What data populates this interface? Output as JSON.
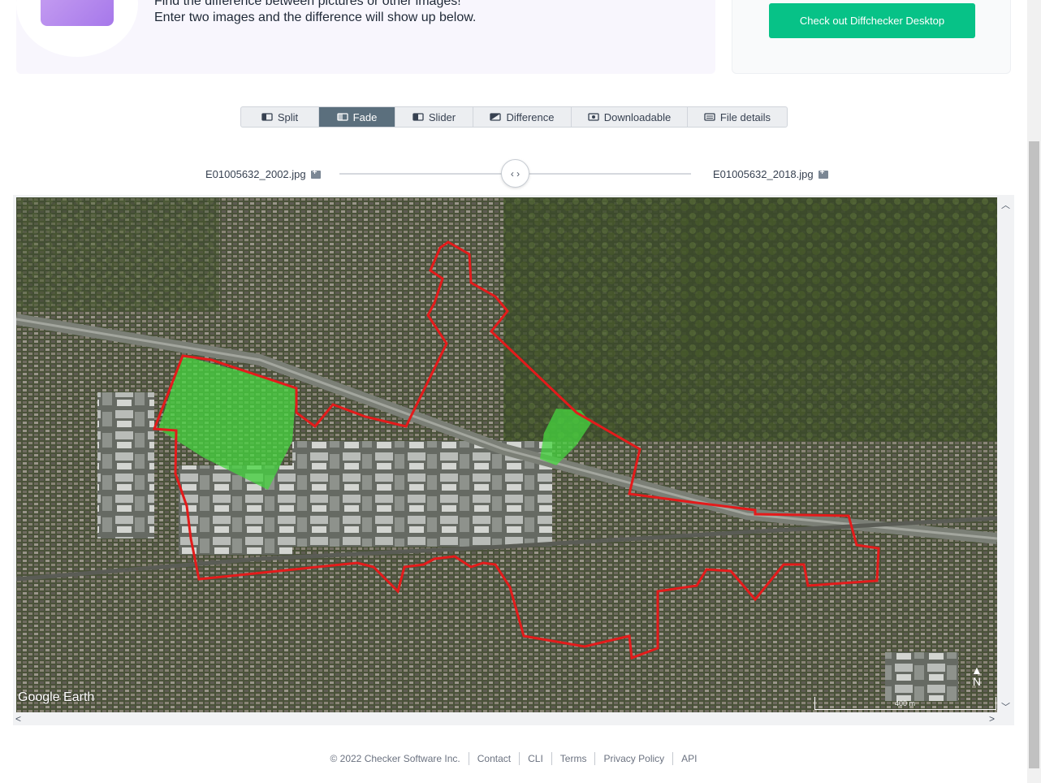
{
  "banner": {
    "line1": "Find the difference between pictures or other images!",
    "line2": "Enter two images and the difference will show up below.",
    "desktop_button": "Check out Diffchecker Desktop"
  },
  "tabs": [
    {
      "label": "Split",
      "icon": "split-icon",
      "active": false
    },
    {
      "label": "Fade",
      "icon": "fade-icon",
      "active": true
    },
    {
      "label": "Slider",
      "icon": "slider-icon",
      "active": false
    },
    {
      "label": "Difference",
      "icon": "difference-icon",
      "active": false
    },
    {
      "label": "Downloadable",
      "icon": "downloadable-icon",
      "active": false
    },
    {
      "label": "File details",
      "icon": "file-details-icon",
      "active": false
    }
  ],
  "fade": {
    "left_file": "E01005632_2002.jpg",
    "right_file": "E01005632_2018.jpg",
    "handle_symbol": "‹ ›",
    "position": 0.5
  },
  "map": {
    "watermark": "Google Earth",
    "scale_label": "400 m",
    "north_label": "N"
  },
  "footer": {
    "copyright": "© 2022 Checker Software Inc.",
    "links": [
      "Contact",
      "CLI",
      "Terms",
      "Privacy Policy",
      "API"
    ]
  },
  "colors": {
    "accent_green": "#07c287",
    "tab_active": "#5b6f7d",
    "boundary_red": "#e31b1b",
    "highlight_green": "#46d63f"
  }
}
